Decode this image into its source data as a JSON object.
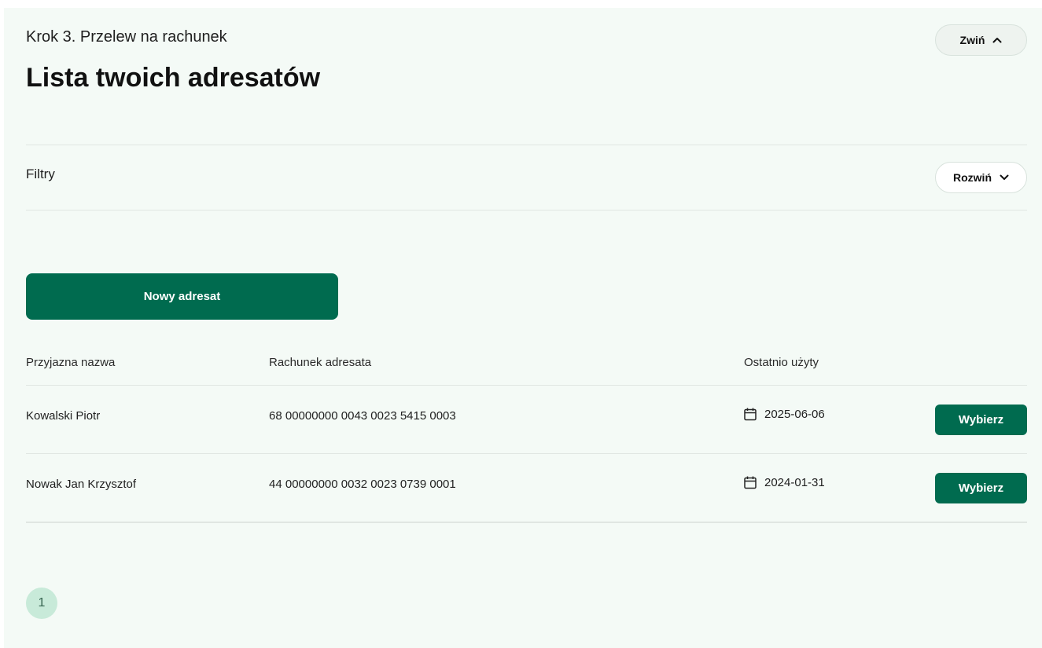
{
  "header": {
    "step_label": "Krok 3. Przelew na rachunek",
    "title": "Lista twoich adresatów",
    "collapse_label": "Zwiń"
  },
  "filters": {
    "label": "Filtry",
    "expand_label": "Rozwiń"
  },
  "actions": {
    "new_recipient_label": "Nowy adresat"
  },
  "table": {
    "columns": [
      "Przyjazna nazwa",
      "Rachunek adresata",
      "Ostatnio użyty"
    ],
    "rows": [
      {
        "name": "Kowalski Piotr",
        "account": "68 00000000 0043 0023 5415 0003",
        "last_used": "2025-06-06",
        "action_label": "Wybierz"
      },
      {
        "name": "Nowak Jan Krzysztof",
        "account": "44 00000000 0032 0023 0739 0001",
        "last_used": "2024-01-31",
        "action_label": "Wybierz"
      }
    ]
  },
  "pagination": {
    "current_page": "1"
  },
  "colors": {
    "panel_background": "#f4faf6",
    "primary_green": "#006b4f",
    "page_chip": "#c8ead9"
  },
  "icons": {
    "collapse": "chevron-up-icon",
    "expand": "chevron-down-icon",
    "date": "calendar-icon"
  }
}
